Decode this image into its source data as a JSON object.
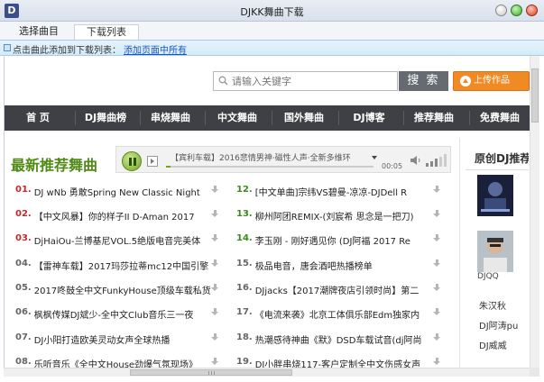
{
  "window": {
    "app_letter": "D",
    "title": "DJKK舞曲下载"
  },
  "tabs": [
    {
      "label": "选择曲目",
      "active": false
    },
    {
      "label": "下载列表",
      "active": true
    }
  ],
  "hint": {
    "text": "点击曲此添加到下载列表：",
    "link": "添加页面中所有"
  },
  "search": {
    "placeholder": "请输入关键字",
    "button": "搜 索",
    "upload": "上传作品"
  },
  "nav": [
    "首 页",
    "DJ舞曲榜",
    "串烧舞曲",
    "中文舞曲",
    "国外舞曲",
    "DJ博客",
    "推荐舞曲",
    "免费舞曲"
  ],
  "section": {
    "title": "最新推荐舞曲"
  },
  "player": {
    "now_playing": "【宾利车载】2016悲情男神·磁性人声·全新多维环",
    "time": "00:05",
    "progress": 0.02,
    "volume_level": 0.6
  },
  "songs_left": [
    {
      "num": "01.",
      "title": "DJ wNb 勇敢Spring New Classic Night",
      "color": "#c62828"
    },
    {
      "num": "02.",
      "title": "【中文风暴】你的样子II D-Aman 2017",
      "color": "#c62828"
    },
    {
      "num": "03.",
      "title": "DjHaiOu-兰博基尼VOL.5绝版电音完美体",
      "color": "#c62828"
    },
    {
      "num": "04.",
      "title": "【雷神车载】2017玛莎拉蒂mc12中国引擎",
      "color": "#666666"
    },
    {
      "num": "05.",
      "title": "2017咚鼓全中文FunkyHouse顶级车载私货",
      "color": "#666666"
    },
    {
      "num": "06.",
      "title": "枫枫传媒DJ斌少-全中文Club音乐三一夜",
      "color": "#666666"
    },
    {
      "num": "07.",
      "title": "DJ小阳打造欧美灵动女声全球热播",
      "color": "#666666"
    },
    {
      "num": "08.",
      "title": "乐听音乐《全中文House劲爆气氛现场》",
      "color": "#666666"
    }
  ],
  "songs_right": [
    {
      "num": "12.",
      "title": "[中文单曲]宗纬VS碧曼-凉凉-DJDell R",
      "color": "#3c8a1c"
    },
    {
      "num": "13.",
      "title": "柳州阿团REMIX-(刘宸希 思念是一把刀)",
      "color": "#3c8a1c"
    },
    {
      "num": "14.",
      "title": "李玉刚 - 刚好遇见你 (DJ阿福 2017 Re",
      "color": "#3c8a1c"
    },
    {
      "num": "15.",
      "title": "极品电音，唐会酒吧热播榜单",
      "color": "#666666"
    },
    {
      "num": "16.",
      "title": "DJjacks【2017潮牌夜店引领时尚】第二",
      "color": "#666666"
    },
    {
      "num": "17.",
      "title": "《电流来袭》北京工体俱乐部Edm独家内",
      "color": "#666666"
    },
    {
      "num": "18.",
      "title": "热潮感待神曲《默》DSD车载试音(dj阿尚",
      "color": "#666666"
    },
    {
      "num": "19.",
      "title": "DJ小胖串烧117-客户定制全中文伤感女声",
      "color": "#666666"
    }
  ],
  "right_panel": {
    "title": "原创DJ推荐",
    "dj_card_name": "DJQQ",
    "djs": [
      "朱汉秋",
      "DJ阿涛pu",
      "DJ威威"
    ]
  }
}
